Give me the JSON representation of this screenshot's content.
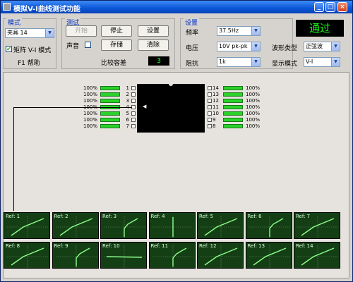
{
  "window": {
    "title": "模拟V-I曲线测试功能"
  },
  "mode": {
    "group_label": "模式",
    "fixture_select": "夹具 14",
    "matrix_checkbox_label": "矩阵 V-I 模式",
    "matrix_checked": true,
    "help_label": "F1 帮助"
  },
  "test": {
    "group_label": "测试",
    "start_label": "开始",
    "stop_label": "停止",
    "setup_label": "设置",
    "sound_label": "声音",
    "save_label": "存储",
    "clear_label": "清除",
    "tolerance_label": "比较容差",
    "tolerance_value": "3"
  },
  "settings": {
    "group_label": "设置",
    "frequency_label": "频率",
    "frequency_value": "37.5Hz",
    "voltage_label": "电压",
    "voltage_value": "10V pk-pk",
    "impedance_label": "阻抗",
    "impedance_value": "1k",
    "waveform_label": "波形类型",
    "waveform_value": "正弦波",
    "display_label": "显示模式",
    "display_value": "V-I"
  },
  "status": {
    "result": "通过",
    "color": "#19ff19"
  },
  "pins_left": [
    {
      "num": "1",
      "pct": "100%"
    },
    {
      "num": "2",
      "pct": "100%"
    },
    {
      "num": "3",
      "pct": "100%"
    },
    {
      "num": "4",
      "pct": "100%"
    },
    {
      "num": "5",
      "pct": "100%"
    },
    {
      "num": "6",
      "pct": "100%"
    },
    {
      "num": "7",
      "pct": "100%"
    }
  ],
  "pins_right": [
    {
      "num": "14",
      "pct": "100%"
    },
    {
      "num": "13",
      "pct": "100%"
    },
    {
      "num": "12",
      "pct": "100%"
    },
    {
      "num": "11",
      "pct": "100%"
    },
    {
      "num": "10",
      "pct": "100%"
    },
    {
      "num": "9",
      "pct": "100%"
    },
    {
      "num": "8",
      "pct": "100%"
    }
  ],
  "refs": [
    {
      "label": "Ref: 1",
      "curve": "diag"
    },
    {
      "label": "Ref: 2",
      "curve": "diag"
    },
    {
      "label": "Ref: 3",
      "curve": "knee"
    },
    {
      "label": "Ref: 4",
      "curve": "vertical"
    },
    {
      "label": "Ref: 5",
      "curve": "diag"
    },
    {
      "label": "Ref: 6",
      "curve": "knee"
    },
    {
      "label": "Ref: 7",
      "curve": "diag"
    },
    {
      "label": "Ref: 8",
      "curve": "diag"
    },
    {
      "label": "Ref: 9",
      "curve": "knee"
    },
    {
      "label": "Ref: 10",
      "curve": "flat"
    },
    {
      "label": "Ref: 11",
      "curve": "knee"
    },
    {
      "label": "Ref: 12",
      "curve": "diag"
    },
    {
      "label": "Ref: 13",
      "curve": "diag"
    },
    {
      "label": "Ref: 14",
      "curve": "diag"
    }
  ],
  "colors": {
    "accent": "#0032c8",
    "bar": "#2ad12a",
    "curve": "#8cff8c",
    "panel": "#143f14"
  }
}
